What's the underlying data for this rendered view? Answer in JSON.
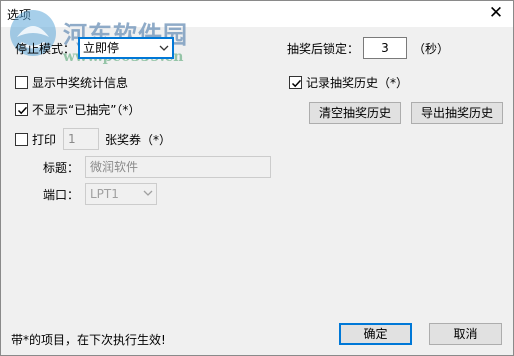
{
  "window": {
    "title": "选项",
    "close_glyph": "✕"
  },
  "watermark": {
    "name": "河东软件园",
    "url": "www.pc0359.cn"
  },
  "stop_mode": {
    "label": "停止模式：",
    "value": "立即停"
  },
  "lock_after": {
    "label": "抽奖后锁定：",
    "value": "3",
    "unit": "（秒）"
  },
  "show_stats": {
    "label": "显示中奖统计信息",
    "checked": false
  },
  "record_history": {
    "label": "记录抽奖历史（*）",
    "checked": true
  },
  "hide_drawn": {
    "label": "不显示“已抽完”（*）",
    "checked": true
  },
  "clear_history_button": "清空抽奖历史",
  "export_history_button": "导出抽奖历史",
  "print": {
    "label": "打印",
    "checked": false,
    "count": "1",
    "count_suffix": "张奖券（*）",
    "title_label": "标题：",
    "title_value": "微润软件",
    "port_label": "端口：",
    "port_value": "LPT1"
  },
  "footer_note": "带*的项目，在下次执行生效!",
  "ok_button": "确定",
  "cancel_button": "取消",
  "colors": {
    "focus": "#0078d7",
    "watermark_text": "#7c9dbf",
    "watermark_url": "#8cc0a0"
  },
  "icons": {
    "check": "check-icon",
    "dropdown": "chevron-down-icon",
    "close": "close-icon"
  }
}
